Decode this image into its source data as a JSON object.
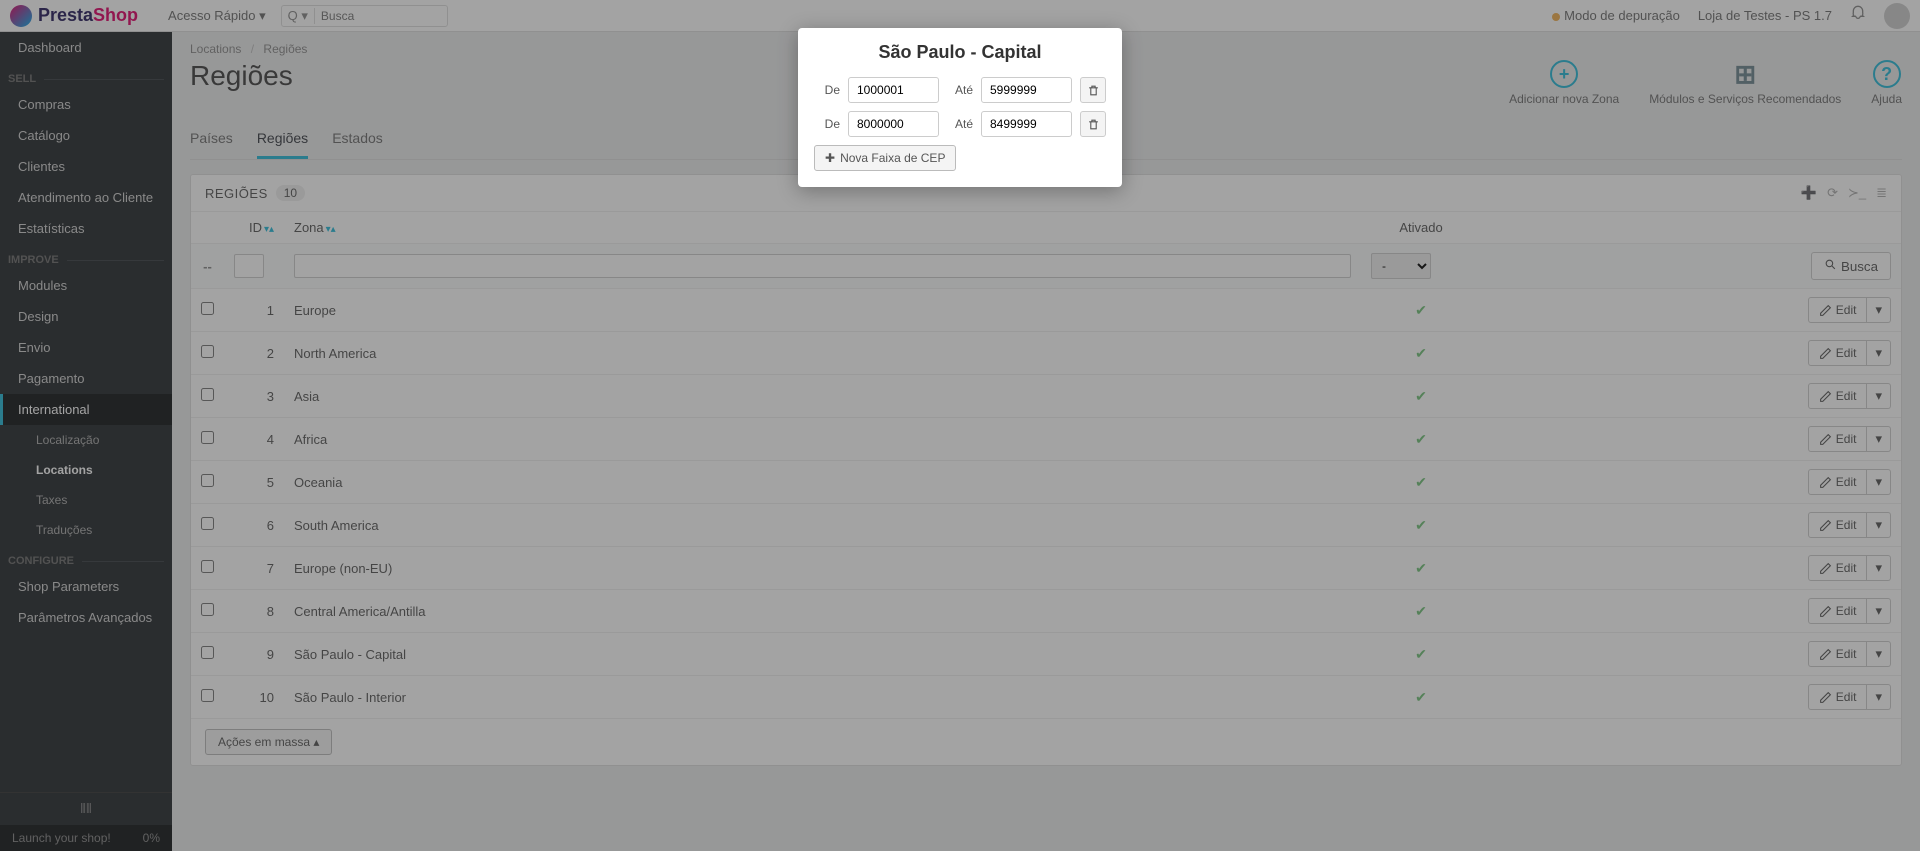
{
  "topbar": {
    "brand_1": "Presta",
    "brand_2": "Shop",
    "quick_access": "Acesso Rápido",
    "search_placeholder": "Busca",
    "debug_mode": "Modo de depuração",
    "shop_name": "Loja de Testes - PS 1.7"
  },
  "sidebar": {
    "dashboard": "Dashboard",
    "sell_heading": "SELL",
    "sell": [
      {
        "label": "Compras"
      },
      {
        "label": "Catálogo"
      },
      {
        "label": "Clientes"
      },
      {
        "label": "Atendimento ao Cliente"
      },
      {
        "label": "Estatísticas"
      }
    ],
    "improve_heading": "IMPROVE",
    "improve": [
      {
        "label": "Modules"
      },
      {
        "label": "Design"
      },
      {
        "label": "Envio"
      },
      {
        "label": "Pagamento"
      },
      {
        "label": "International",
        "active": true
      }
    ],
    "intl_sub": [
      {
        "label": "Localização"
      },
      {
        "label": "Locations",
        "active": true
      },
      {
        "label": "Taxes"
      },
      {
        "label": "Traduções"
      }
    ],
    "configure_heading": "CONFIGURE",
    "configure": [
      {
        "label": "Shop Parameters"
      },
      {
        "label": "Parâmetros Avançados"
      }
    ],
    "launch_label": "Launch your shop!",
    "launch_pct": "0%"
  },
  "breadcrumb": {
    "a": "Locations",
    "b": "Regiões"
  },
  "page": {
    "title": "Regiões",
    "actions": {
      "add_zone": "Adicionar nova Zona",
      "recommended": "Módulos e Serviços Recomendados",
      "help": "Ajuda"
    }
  },
  "tabs": [
    {
      "label": "Países"
    },
    {
      "label": "Regiões",
      "active": true
    },
    {
      "label": "Estados"
    }
  ],
  "panel": {
    "title": "REGIÕES",
    "count": "10",
    "columns": {
      "id": "ID",
      "zone": "Zona",
      "active": "Ativado"
    },
    "filter_placeholder_select": "-",
    "search_btn": "Busca",
    "edit_label": "Edit",
    "bulk_label": "Ações em massa"
  },
  "rows": [
    {
      "id": "1",
      "zone": "Europe"
    },
    {
      "id": "2",
      "zone": "North America"
    },
    {
      "id": "3",
      "zone": "Asia"
    },
    {
      "id": "4",
      "zone": "Africa"
    },
    {
      "id": "5",
      "zone": "Oceania"
    },
    {
      "id": "6",
      "zone": "South America"
    },
    {
      "id": "7",
      "zone": "Europe (non-EU)"
    },
    {
      "id": "8",
      "zone": "Central America/Antilla"
    },
    {
      "id": "9",
      "zone": "São Paulo - Capital"
    },
    {
      "id": "10",
      "zone": "São Paulo - Interior"
    }
  ],
  "modal": {
    "title": "São Paulo - Capital",
    "from_label": "De",
    "to_label": "Até",
    "ranges": [
      {
        "from": "1000001",
        "to": "5999999"
      },
      {
        "from": "8000000",
        "to": "8499999"
      }
    ],
    "add_range": "Nova Faixa de CEP"
  }
}
